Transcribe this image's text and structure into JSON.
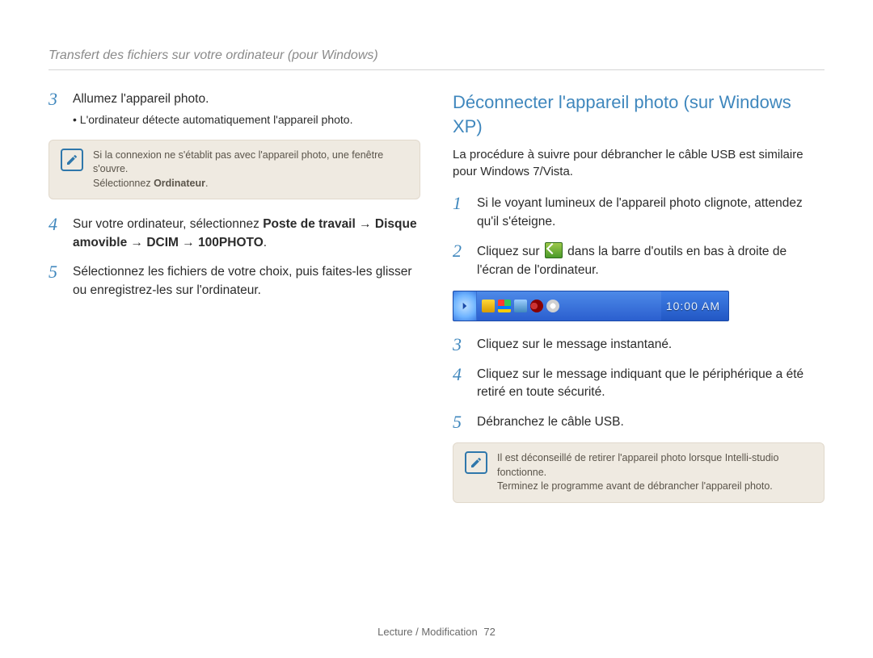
{
  "breadcrumb": "Transfert des fichiers sur votre ordinateur (pour Windows)",
  "left": {
    "steps": [
      {
        "num": "3",
        "text": "Allumez l'appareil photo.",
        "sub": "L'ordinateur détecte automatiquement l'appareil photo."
      },
      {
        "num": "4",
        "pre": "Sur votre ordinateur, sélectionnez ",
        "bold1": "Poste de travail",
        "arrow1": " → ",
        "bold2": "Disque amovible",
        "arrow2": " → ",
        "bold3": "DCIM",
        "arrow3": " → ",
        "bold4": "100PHOTO",
        "post": "."
      },
      {
        "num": "5",
        "text": "Sélectionnez les fichiers de votre choix, puis faites-les glisser ou enregistrez-les sur l'ordinateur."
      }
    ],
    "callout": {
      "line1": "Si la connexion ne s'établit pas avec l'appareil photo, une fenêtre s'ouvre.",
      "line2_pre": "Sélectionnez ",
      "line2_bold": "Ordinateur",
      "line2_post": "."
    }
  },
  "right": {
    "heading": "Déconnecter l'appareil photo (sur Windows XP)",
    "intro": "La procédure à suivre pour débrancher le câble USB est similaire pour Windows 7/Vista.",
    "steps": [
      {
        "num": "1",
        "text": "Si le voyant lumineux de l'appareil photo clignote, attendez qu'il s'éteigne."
      },
      {
        "num": "2",
        "pre": "Cliquez sur ",
        "post": " dans la barre d'outils en bas à droite de l'écran de l'ordinateur."
      },
      {
        "num": "3",
        "text": "Cliquez sur le message instantané."
      },
      {
        "num": "4",
        "text": "Cliquez sur le message indiquant que le périphérique a été retiré en toute sécurité."
      },
      {
        "num": "5",
        "text": "Débranchez le câble USB."
      }
    ],
    "taskbar_time": "10:00 AM",
    "callout": {
      "line1": "Il est déconseillé de retirer l'appareil photo lorsque Intelli-studio fonctionne.",
      "line2": "Terminez le programme avant de débrancher l'appareil photo."
    }
  },
  "footer": {
    "section": "Lecture / Modification",
    "page": "72"
  }
}
